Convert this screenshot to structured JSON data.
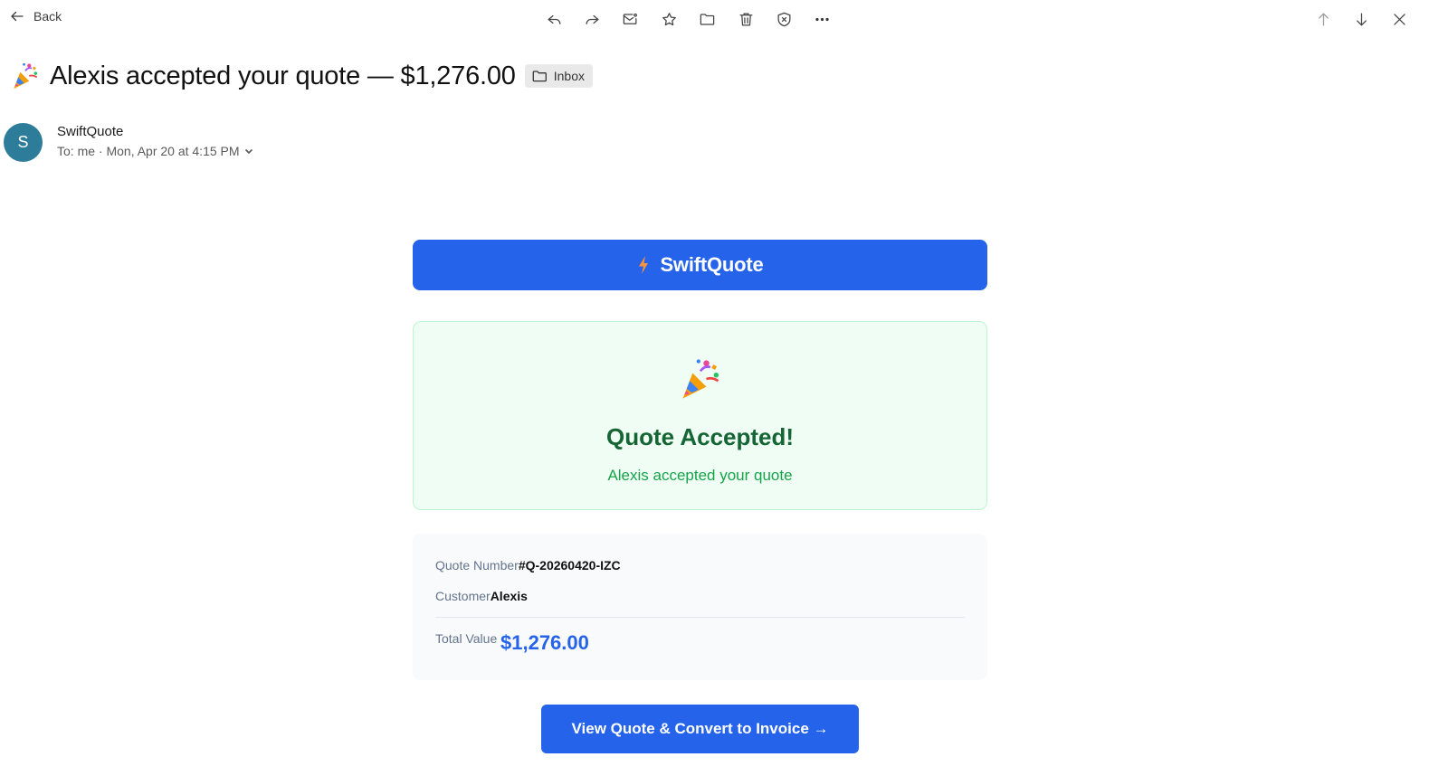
{
  "toolbar": {
    "back_label": "Back",
    "actions": [
      "reply-icon",
      "forward-icon",
      "mark-unread-icon",
      "star-icon",
      "folder-icon",
      "trash-icon",
      "block-icon",
      "more-icon"
    ],
    "nav": [
      "arrow-up-icon",
      "arrow-down-icon",
      "close-icon"
    ]
  },
  "email": {
    "subject": "Alexis accepted your quote — $1,276.00",
    "folder": "Inbox",
    "sender": {
      "avatar_letter": "S",
      "avatar_color": "#2d7d9a",
      "name": "SwiftQuote",
      "meta": "To: me · Mon, Apr 20 at 4:15 PM"
    }
  },
  "body": {
    "brand": {
      "name": "SwiftQuote",
      "color": "#2563eb"
    },
    "accept": {
      "title": "Quote Accepted!",
      "subtitle": "Alexis accepted your quote"
    },
    "details": {
      "quote_number_label": "Quote Number",
      "quote_number": "#Q-20260420-IZC",
      "customer_label": "Customer",
      "customer": "Alexis",
      "total_label": "Total Value",
      "total": "$1,276.00"
    },
    "cta_label": "View Quote & Convert to Invoice →"
  }
}
